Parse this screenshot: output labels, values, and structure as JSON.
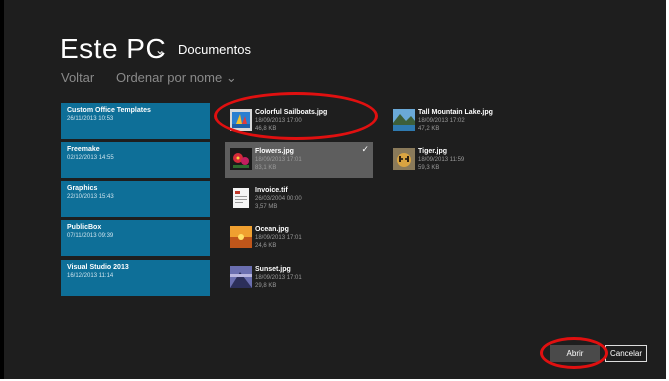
{
  "header": {
    "title": "Este PC",
    "chevron": "⌄",
    "folder": "Documentos"
  },
  "toolbar": {
    "back_label": "Voltar",
    "sort_label": "Ordenar por nome",
    "sort_chevron": "⌄"
  },
  "folders": [
    {
      "name": "Custom Office Templates",
      "date": "26/11/2013 10:53"
    },
    {
      "name": "Freemake",
      "date": "02/12/2013 14:55"
    },
    {
      "name": "Graphics",
      "date": "22/10/2013 15:43"
    },
    {
      "name": "PublicBox",
      "date": "07/11/2013 09:39"
    },
    {
      "name": "Visual Studio 2013",
      "date": "16/12/2013 11:14"
    }
  ],
  "files_col1": [
    {
      "name": "Colorful Sailboats.jpg",
      "date": "18/09/2013 17:00",
      "size": "46,8 KB",
      "thumb": "sailboats-thumbnail"
    },
    {
      "name": "Flowers.jpg",
      "date": "18/09/2013 17:01",
      "size": "83,1 KB",
      "thumb": "flowers-thumbnail"
    },
    {
      "name": "Invoice.tif",
      "date": "26/03/2004 00:00",
      "size": "3,57 MB",
      "thumb": "invoice-thumbnail"
    },
    {
      "name": "Ocean.jpg",
      "date": "18/09/2013 17:01",
      "size": "24,6 KB",
      "thumb": "ocean-thumbnail"
    },
    {
      "name": "Sunset.jpg",
      "date": "18/09/2013 17:01",
      "size": "29,8 KB",
      "thumb": "sunset-thumbnail"
    }
  ],
  "files_col2": [
    {
      "name": "Tall Mountain Lake.jpg",
      "date": "18/09/2013 17:02",
      "size": "47,2 KB",
      "thumb": "mountain-lake-thumbnail"
    },
    {
      "name": "Tiger.jpg",
      "date": "18/09/2013 11:59",
      "size": "59,3 KB",
      "thumb": "tiger-thumbnail"
    }
  ],
  "selected_check": "✓",
  "buttons": {
    "open_label": "Abrir",
    "cancel_label": "Cancelar"
  },
  "colors": {
    "folder_tile": "#0e6f98",
    "annotation": "#e01010",
    "selection": "#5e5e5e"
  }
}
